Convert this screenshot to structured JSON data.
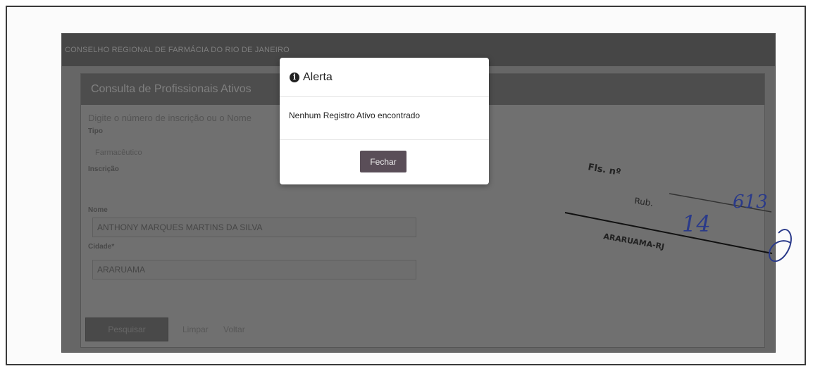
{
  "topbar": {
    "title": "CONSELHO REGIONAL DE FARMÁCIA DO RIO DE JANEIRO"
  },
  "panel": {
    "title": "Consulta de Profissionais Ativos",
    "instruction": "Digite o número de inscrição ou o Nome",
    "tipo_label": "Tipo",
    "tipo_value": "Farmacêutico",
    "inscricao_label": "Inscrição",
    "inscricao_value": "",
    "nome_label": "Nome",
    "nome_value": "ANTHONY MARQUES MARTINS DA SILVA",
    "cidade_label": "Cidade*",
    "cidade_value": "ARARUAMA",
    "pesquisar_label": "Pesquisar",
    "limpar_label": "Limpar",
    "voltar_label": "Voltar"
  },
  "modal": {
    "title": "Alerta",
    "icon": "info-icon",
    "message": "Nenhum Registro Ativo encontrado",
    "close_label": "Fechar"
  },
  "stamp": {
    "line1": "Fls. nº",
    "line2": "Rub.",
    "number": "14",
    "fraction": "613",
    "footer": "ARARUAMA-RJ"
  }
}
